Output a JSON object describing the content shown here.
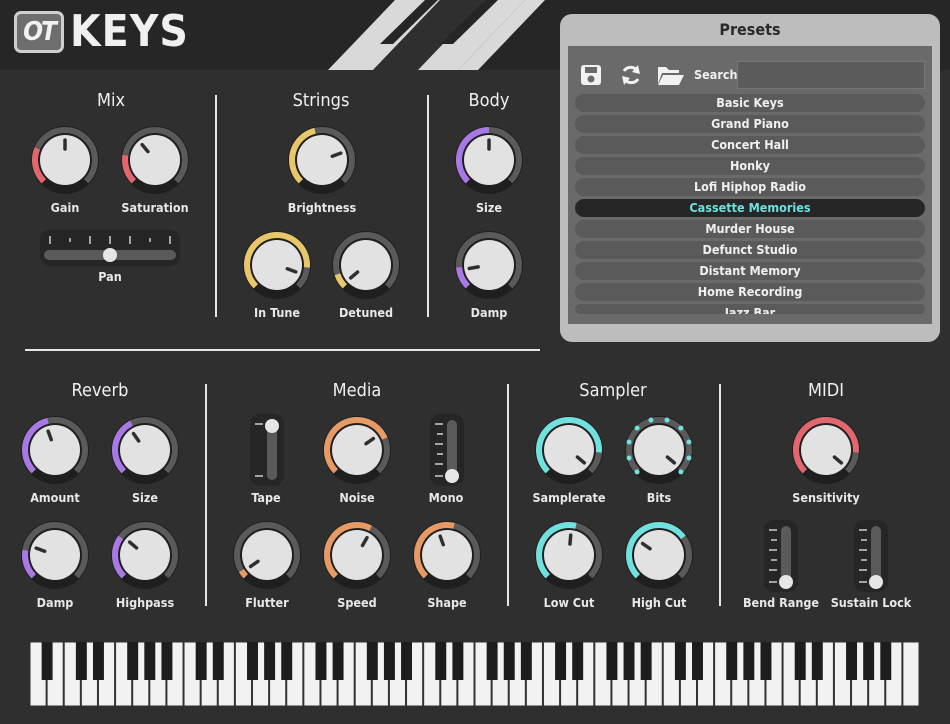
{
  "app": {
    "logo_ot": "OT",
    "logo_keys": "KEYS"
  },
  "colors": {
    "red": "#e2666e",
    "yellow": "#e8c76a",
    "purple": "#a978e6",
    "orange": "#e89a64",
    "cyan": "#6fe1df"
  },
  "sections": {
    "mix": "Mix",
    "strings": "Strings",
    "body": "Body",
    "reverb": "Reverb",
    "media": "Media",
    "sampler": "Sampler",
    "midi": "MIDI"
  },
  "controls": {
    "gain": "Gain",
    "saturation": "Saturation",
    "pan": "Pan",
    "brightness": "Brightness",
    "in_tune": "In Tune",
    "detuned": "Detuned",
    "size": "Size",
    "damp": "Damp",
    "amount": "Amount",
    "rev_size": "Size",
    "rev_damp": "Damp",
    "highpass": "Highpass",
    "tape": "Tape",
    "noise": "Noise",
    "mono": "Mono",
    "flutter": "Flutter",
    "speed": "Speed",
    "shape": "Shape",
    "samplerate": "Samplerate",
    "bits": "Bits",
    "low_cut": "Low Cut",
    "high_cut": "High Cut",
    "sensitivity": "Sensitivity",
    "bend_range": "Bend Range",
    "sustain_lock": "Sustain Lock"
  },
  "presets": {
    "title": "Presets",
    "search_label": "Search",
    "search_value": "",
    "items": [
      "Basic Keys",
      "Grand Piano",
      "Concert Hall",
      "Honky",
      "Lofi Hiphop Radio",
      "Cassette Memories",
      "Murder House",
      "Defunct Studio",
      "Distant Memory",
      "Home Recording",
      "Jazz Bar"
    ],
    "selected": "Cassette Memories"
  },
  "icons": {
    "save": "save-icon",
    "refresh": "refresh-icon",
    "folder": "folder-icon"
  }
}
